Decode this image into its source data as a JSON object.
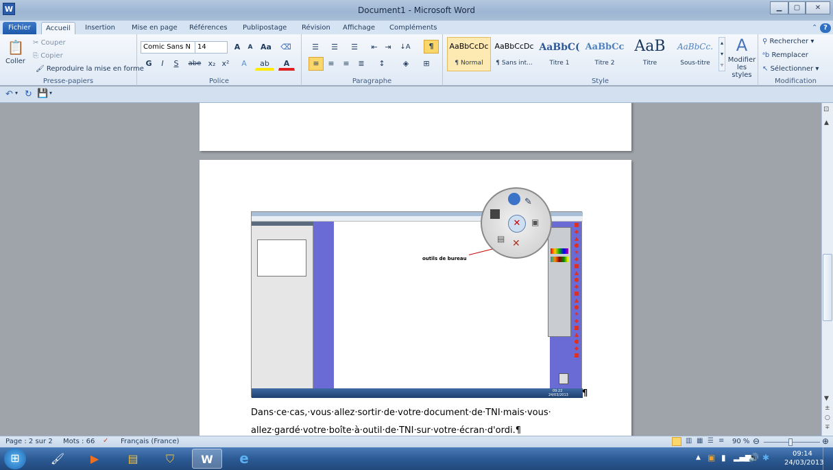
{
  "window": {
    "title": "Document1  -  Microsoft Word",
    "app_icon": "W",
    "controls": [
      "—",
      "☐",
      "✕"
    ]
  },
  "tabs": [
    "Fichier",
    "Accueil",
    "Insertion",
    "Mise en page",
    "Références",
    "Publipostage",
    "Révision",
    "Affichage",
    "Compléments"
  ],
  "clipboard": {
    "paste": "Coller",
    "cut": "Couper",
    "copy": "Copier",
    "format_painter": "Reproduire la mise en forme",
    "label": "Presse-papiers"
  },
  "font": {
    "name": "Comic Sans N",
    "size": "14",
    "label": "Police"
  },
  "paragraph": {
    "label": "Paragraphe"
  },
  "styles": {
    "items": [
      {
        "preview": "AaBbCcDc",
        "name": "¶ Normal"
      },
      {
        "preview": "AaBbCcDc",
        "name": "¶ Sans int..."
      },
      {
        "preview": "AaBbC(",
        "name": "Titre 1"
      },
      {
        "preview": "AaBbCc",
        "name": "Titre 2"
      },
      {
        "preview": "AaB",
        "name": "Titre"
      },
      {
        "preview": "AaBbCc.",
        "name": "Sous-titre"
      }
    ],
    "modify": "Modifier les styles",
    "label": "Style"
  },
  "editing": {
    "find": "Rechercher",
    "replace": "Remplacer",
    "select": "Sélectionner",
    "label": "Modification"
  },
  "document": {
    "annotation": "outils de bureau",
    "line1": "Dans·ce·cas,·vous·allez·sortir·de·votre·document·de·TNI·mais·vous·",
    "line2": "allez·gardé·votre·boîte·à·outil·de·TNI·sur·votre·écran·d'ordi.¶",
    "inner_time": "09:22",
    "inner_date": "24/03/2013"
  },
  "status": {
    "page": "Page : 2 sur 2",
    "words": "Mots : 66",
    "language": "Français (France)",
    "zoom": "90 %"
  },
  "taskbar": {
    "time": "09:14",
    "date": "24/03/2013"
  }
}
